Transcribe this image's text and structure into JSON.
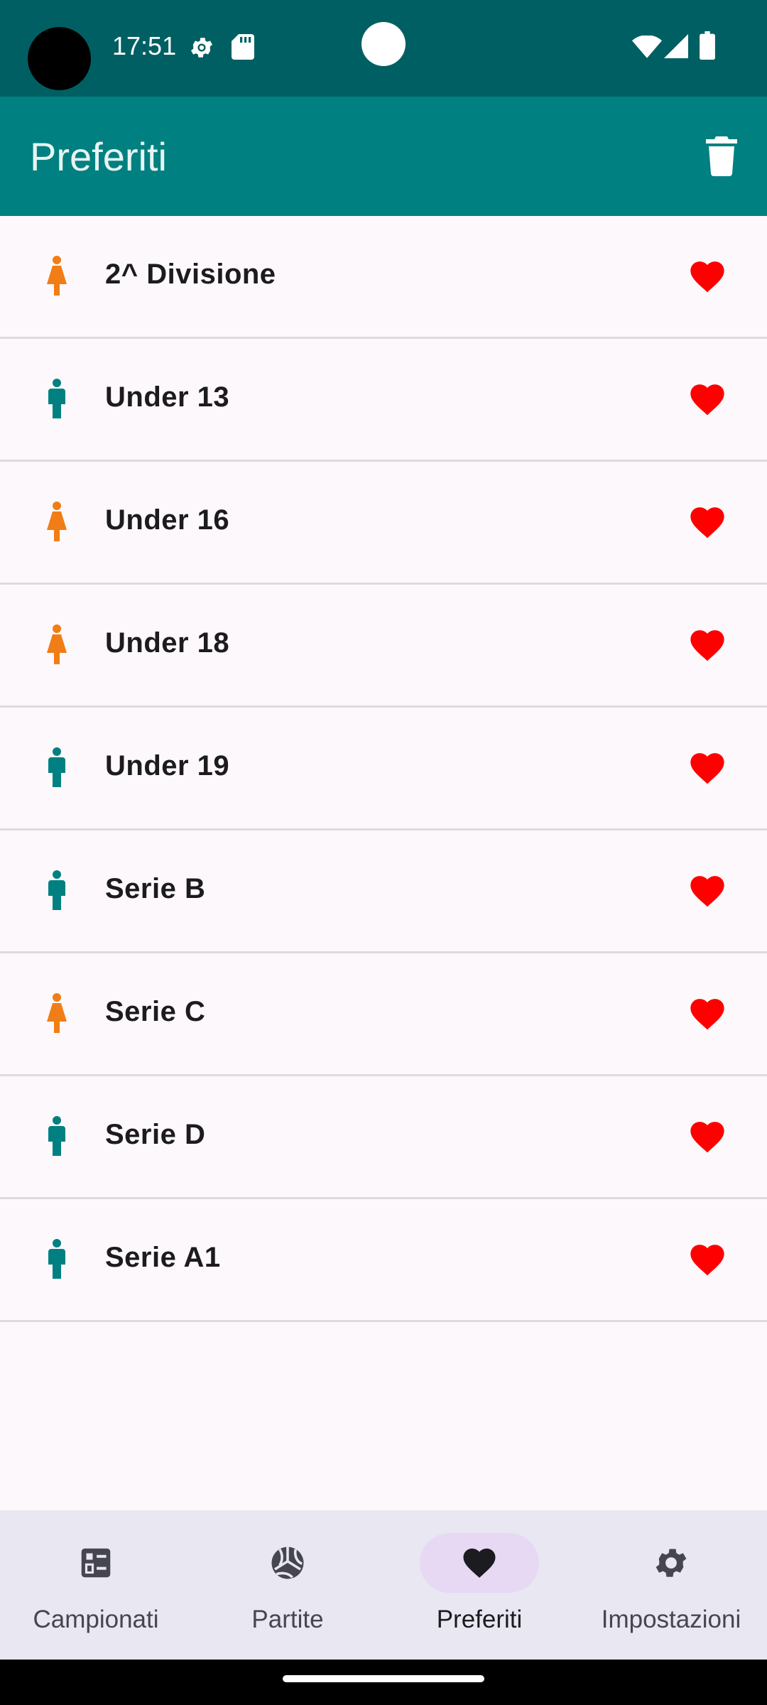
{
  "status_bar": {
    "time": "17:51",
    "icons": [
      "settings-gear-icon",
      "sd-card-icon",
      "wifi-icon",
      "cell-signal-icon",
      "battery-icon"
    ]
  },
  "app_bar": {
    "title": "Preferiti",
    "action_icon": "trash-icon"
  },
  "list": {
    "items": [
      {
        "label": "2^ Divisione",
        "gender": "female",
        "icon_color": "#f07d16",
        "favorite": true
      },
      {
        "label": "Under 13",
        "gender": "male",
        "icon_color": "#008080",
        "favorite": true
      },
      {
        "label": "Under 16",
        "gender": "female",
        "icon_color": "#f07d16",
        "favorite": true
      },
      {
        "label": "Under 18",
        "gender": "female",
        "icon_color": "#f07d16",
        "favorite": true
      },
      {
        "label": "Under 19",
        "gender": "male",
        "icon_color": "#008080",
        "favorite": true
      },
      {
        "label": "Serie B",
        "gender": "male",
        "icon_color": "#008080",
        "favorite": true
      },
      {
        "label": "Serie C",
        "gender": "female",
        "icon_color": "#f07d16",
        "favorite": true
      },
      {
        "label": "Serie D",
        "gender": "male",
        "icon_color": "#008080",
        "favorite": true
      },
      {
        "label": "Serie A1",
        "gender": "male",
        "icon_color": "#008080",
        "favorite": true
      }
    ]
  },
  "nav": {
    "items": [
      {
        "label": "Campionati",
        "icon": "leaderboard-list-icon",
        "active": false
      },
      {
        "label": "Partite",
        "icon": "volleyball-icon",
        "active": false
      },
      {
        "label": "Preferiti",
        "icon": "heart-icon",
        "active": true
      },
      {
        "label": "Impostazioni",
        "icon": "gear-icon",
        "active": false
      }
    ]
  },
  "colors": {
    "status_bar": "#005f63",
    "app_bar": "#008080",
    "heart": "#ff0000",
    "female": "#f07d16",
    "male": "#008080",
    "nav_background": "#e9e7f1",
    "nav_active_pill": "#e7d9f3"
  }
}
